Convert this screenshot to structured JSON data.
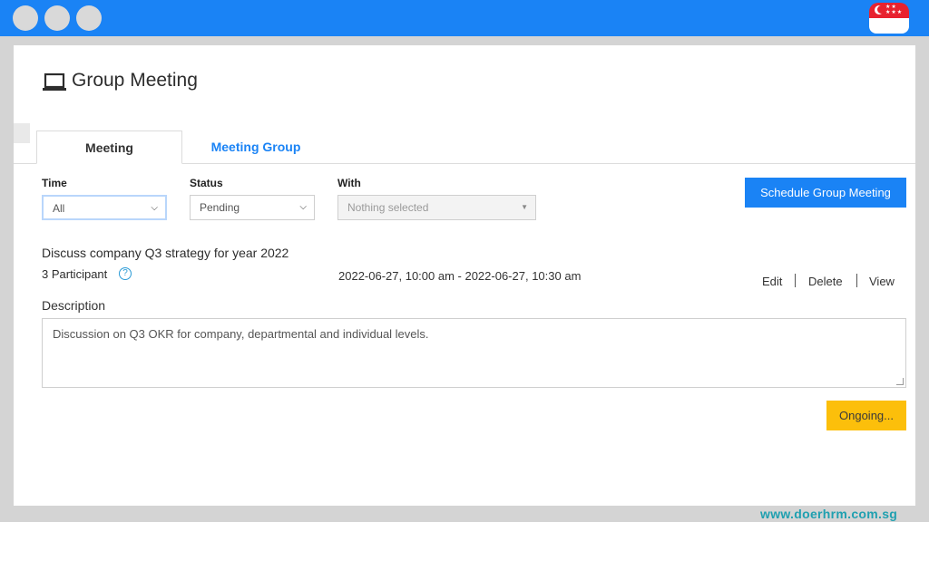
{
  "window": {
    "controls": [
      "close",
      "minimize",
      "maximize"
    ],
    "flag_icon": "singapore-flag-icon"
  },
  "page": {
    "title": "Group Meeting",
    "title_icon": "monitor-icon"
  },
  "tabs": [
    {
      "label": "Meeting",
      "active": true
    },
    {
      "label": "Meeting Group",
      "active": false
    }
  ],
  "filters": {
    "time": {
      "label": "Time",
      "value": "All"
    },
    "status": {
      "label": "Status",
      "value": "Pending"
    },
    "with": {
      "label": "With",
      "placeholder": "Nothing selected"
    }
  },
  "schedule_button": "Schedule Group Meeting",
  "meeting": {
    "title": "Discuss company Q3 strategy for year 2022",
    "participants": "3 Participant",
    "datetime": "2022-06-27, 10:00 am - 2022-06-27, 10:30 am",
    "actions": {
      "edit": "Edit",
      "delete": "Delete",
      "view": "View"
    },
    "description_label": "Description",
    "description": "Discussion on Q3 OKR for company, departmental and individual levels.",
    "status_button": "Ongoing..."
  },
  "footer": {
    "url": "www.doerhrm.com.sg"
  },
  "colors": {
    "accent": "#1a83f5",
    "warning": "#fcbf0b",
    "url": "#20a0b0"
  }
}
